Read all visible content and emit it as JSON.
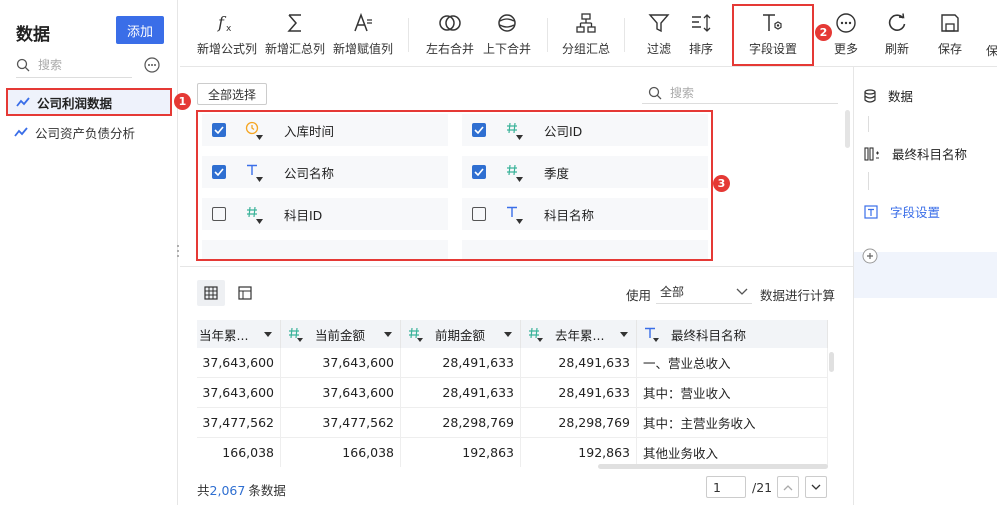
{
  "left_panel": {
    "title": "数据",
    "add_label": "添加",
    "search_placeholder": "搜索",
    "items": [
      {
        "label": "公司利润数据",
        "badge": "1"
      },
      {
        "label": "公司资产负债分析"
      }
    ]
  },
  "toolbar": {
    "items": [
      {
        "label": "新增公式列",
        "icon": "fx-icon"
      },
      {
        "label": "新增汇总列",
        "icon": "sigma-icon"
      },
      {
        "label": "新增赋值列",
        "icon": "assign-icon"
      },
      {
        "label": "左右合并",
        "icon": "merge-horizontal-icon"
      },
      {
        "label": "上下合并",
        "icon": "merge-vertical-icon"
      },
      {
        "label": "分组汇总",
        "icon": "group-icon"
      },
      {
        "label": "过滤",
        "icon": "filter-icon"
      },
      {
        "label": "排序",
        "icon": "sort-icon"
      },
      {
        "label": "字段设置",
        "icon": "field-settings-icon",
        "badge": "2"
      },
      {
        "label": "更多",
        "icon": "more-icon"
      },
      {
        "label": "刷新",
        "icon": "refresh-icon"
      },
      {
        "label": "保存",
        "icon": "save-icon"
      },
      {
        "label": "保"
      }
    ]
  },
  "field_panel": {
    "select_all_label": "全部选择",
    "search_placeholder": "搜索",
    "badge": "3",
    "fields": [
      {
        "name": "入库时间",
        "type": "time",
        "checked": true
      },
      {
        "name": "公司ID",
        "type": "number",
        "checked": true
      },
      {
        "name": "公司名称",
        "type": "text",
        "checked": true
      },
      {
        "name": "季度",
        "type": "number",
        "checked": true
      },
      {
        "name": "科目ID",
        "type": "number",
        "checked": false
      },
      {
        "name": "科目名称",
        "type": "text",
        "checked": false
      }
    ]
  },
  "right_panel": {
    "steps": [
      {
        "label": "数据",
        "icon": "database-icon"
      },
      {
        "label": "最终科目名称",
        "icon": "column-split-icon"
      },
      {
        "label": "字段设置",
        "icon": "text-field-icon"
      }
    ]
  },
  "table_section": {
    "use_label": "使用",
    "use_value": "全部",
    "calc_label": "数据进行计算",
    "columns": [
      {
        "label": "当年累...",
        "type": "none"
      },
      {
        "label": "当前金额",
        "type": "number"
      },
      {
        "label": "前期金额",
        "type": "number"
      },
      {
        "label": "去年累...",
        "type": "number"
      },
      {
        "label": "最终科目名称",
        "type": "text"
      }
    ],
    "rows": [
      [
        "37,643,600",
        "37,643,600",
        "28,491,633",
        "28,491,633",
        "一、营业总收入"
      ],
      [
        "37,643,600",
        "37,643,600",
        "28,491,633",
        "28,491,633",
        "其中：营业收入"
      ],
      [
        "37,477,562",
        "37,477,562",
        "28,298,769",
        "28,298,769",
        "其中：主营业务收入"
      ],
      [
        "166,038",
        "166,038",
        "192,863",
        "192,863",
        "其他业务收入"
      ]
    ],
    "total_prefix": "共",
    "total_count": "2,067",
    "total_suffix": "条数据",
    "page_value": "1",
    "page_total": "/21"
  },
  "colors": {
    "accent": "#3a6ee8",
    "highlight_border": "#e53935",
    "number_type": "#3bb39a",
    "text_type": "#3a6ee8",
    "time_type": "#f5a623"
  }
}
